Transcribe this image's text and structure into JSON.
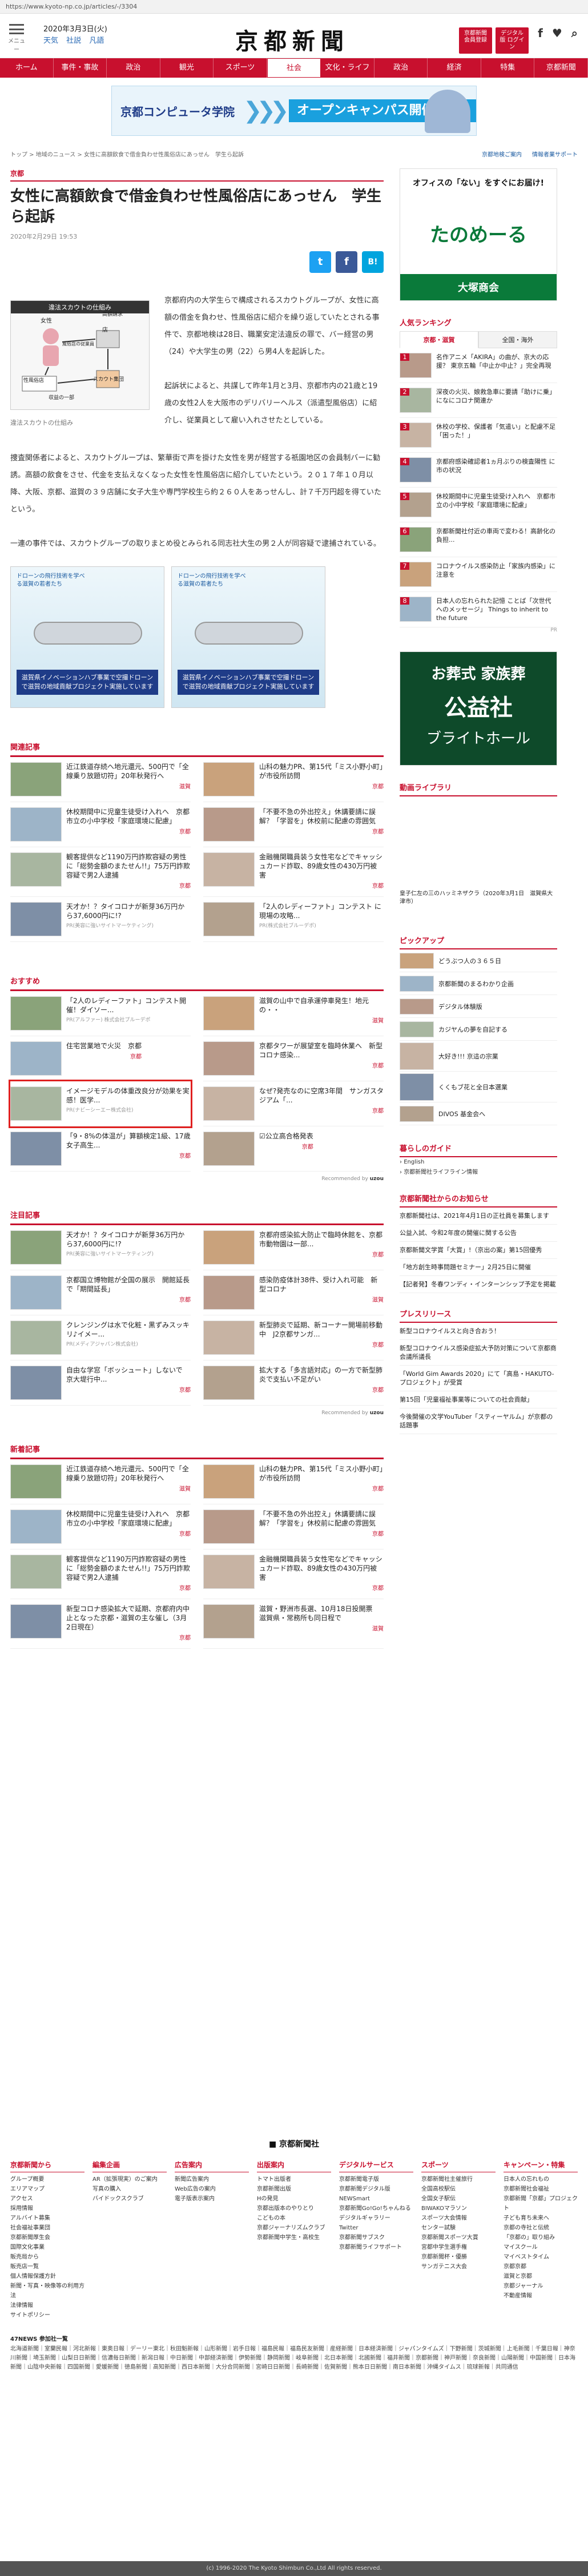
{
  "url": "https://www.kyoto-np.co.jp/articles/-/3304",
  "header": {
    "menu_label": "メニュー",
    "date": "2020年3月3日(火)",
    "weather_links": [
      "天気",
      "社説",
      "凡語"
    ],
    "logo": "京都新聞",
    "buttons": [
      "京都新聞 会員登録",
      "デジタル版 ログイン"
    ],
    "social": [
      "f",
      "Facebook",
      "Twitter"
    ],
    "social_icons": [
      "f-icon",
      "twitter-icon",
      "search-icon"
    ]
  },
  "nav": [
    "ホーム",
    "事件・事故",
    "政治",
    "観光",
    "スポーツ",
    "社会",
    "文化・ライフ",
    "政治",
    "経済",
    "特集",
    "京都新聞"
  ],
  "nav_active": 5,
  "banner": {
    "school": "京都コンピュータ学院",
    "tag": "オープンキャンパス開催中"
  },
  "breadcrumb": "トップ > 地域のニュース > 女性に高額飲食で借金負わせ性風俗店にあっせん　学生ら起訴",
  "breadcrumb_right": [
    "京都地検ご案内",
    "情報者業サポート"
  ],
  "article": {
    "category": "京都",
    "title": "女性に高額飲食で借金負わせ性風俗店にあっせん　学生ら起訴",
    "date": "2020年2月29日 19:53",
    "share": [
      "t",
      "f",
      "B!"
    ],
    "figure_title": "違法スカウトの仕組み",
    "figure_labels": [
      "女性",
      "店",
      "高額請求",
      "スカウト集団",
      "性風俗店",
      "風俗店の従業員",
      "収益の一部"
    ],
    "figure_caption": "違法スカウトの仕組み",
    "p1": "京都府内の大学生らで構成されるスカウトグループが、女性に高額の借金を負わせ、性風俗店に紹介を繰り返していたとされる事件で、京都地検は28日、職業安定法違反の罪で、バー経営の男（24）や大学生の男（22）ら男4人を起訴した。",
    "p2": "起訴状によると、共謀して昨年1月と3月、京都市内の21歳と19歳の女性2人を大阪市のデリバリーヘルス（派遣型風俗店）に紹介し、従業員として雇い入れさせたとしている。",
    "p3": "捜査関係者によると、スカウトグループは、繁華街で声を掛けた女性を男が経営する祇園地区の会員制バーに勧誘。高額の飲食をさせ、代金を支払えなくなった女性を性風俗店に紹介していたという。２０１７年１０月以降、大阪、京都、滋賀の３９店舗に女子大生や専門学校生ら約２６０人をあっせんし、計７千万円超を得ていたという。",
    "p4": "一連の事件では、スカウトグループの取りまとめ役とみられる同志社大生の男２人が同容疑で逮捕されている。"
  },
  "ads": [
    {
      "top": "ドローンの飛行技術を学べる滋賀の若者たち",
      "band": "滋賀県イノベーションハブ事業で空撮ドローンで滋賀の地域貢献プロジェクト実施しています"
    },
    {
      "top": "ドローンの飛行技術を学べる滋賀の若者たち",
      "band": "滋賀県イノベーションハブ事業で空撮ドローンで滋賀の地域貢献プロジェクト実施しています"
    }
  ],
  "related": {
    "heading": "関連記事",
    "items": [
      {
        "text": "近江鉄道存続へ地元還元、500円で「全線乗り放題切符」20年秋発行へ",
        "cat": "滋賀"
      },
      {
        "text": "山科の魅力PR、第15代「ミス小野小町」が市役所訪問",
        "cat": "京都"
      },
      {
        "text": "休校期間中に児童生徒受け入れへ　京都市立の小中学校「家庭環境に配慮」",
        "cat": "京都"
      },
      {
        "text": "「不要不急の外出控え」休講要請に誤解？「学習を」休校前に配慮の雰囲気",
        "cat": "京都"
      },
      {
        "text": "観客提供など1190万円詐欺容疑の男性に「総勢金額のまたせん!!」75万円詐欺　容疑で男2人逮捕",
        "cat": "京都"
      },
      {
        "text": "金融機関職員装う女性宅などでキャッシュカード詐取、89歳女性の430万円被害",
        "cat": "京都"
      },
      {
        "text": "天才か！？タイコロナが新芽36万円から37,6000円に!?",
        "pr": "PR(美容に強いサイトマーケティング)"
      },
      {
        "text": "「2人のレディーファト」コンテスト に 現場の攻略...",
        "pr": "PR(株式会社ブルーデポ)"
      }
    ]
  },
  "recommend": {
    "heading": "おすすめ",
    "items": [
      {
        "text": "「2人のレディーファト」コンテスト開催！ダイソー...",
        "pr": "PR(アルファー) 株式会社プルーデポ"
      },
      {
        "text": "滋賀の山中で自承運停車発生！地元の・・",
        "cat": "滋賀"
      },
      {
        "text": "住宅営業地で火災　京都",
        "cat": "京都"
      },
      {
        "text": "京都タワーが展望室を臨時休業へ　新型コロナ感染...",
        "cat": "京都"
      },
      {
        "text": "イメージモデルの体重改良分が効果を実感！医学...",
        "pr": "PR(ナビーシーエー株式会社)",
        "hl": true
      },
      {
        "text": "なぜ?発売なのに空席3年間　サンガスタジアム「...",
        "cat": "京都"
      },
      {
        "text": "「9・8%の体温が」算額検定1級、17歳女子高生...",
        "cat": "京都"
      },
      {
        "text": "☑公立高合格発表",
        "cat": "京都"
      }
    ],
    "by": "Recommended by",
    "by_brand": "uzou"
  },
  "featured": {
    "heading": "注目記事",
    "items": [
      {
        "text": "天才か！？タイコロナが新芽36万円から37,6000円に!?",
        "pr": "PR(美容に強いサイトマーケティング)"
      },
      {
        "text": "京都府感染拡大防止で臨時休館を、京都市動物園は一部...",
        "cat": "京都"
      },
      {
        "text": "京都国立博物館が全国の展示　開館延長で「期間延長」",
        "cat": "京都"
      },
      {
        "text": "感染防疫体計38件、受け入れ可能　新型コロナ",
        "cat": "滋賀"
      },
      {
        "text": "クレンジングは水で化粧・黒ずみスッキリ♪イメー...",
        "pr": "PR(メディアジャパン株式会社)"
      },
      {
        "text": "新型肺炎で延期、新コーナー開場前移動中　J2京都サンガ...",
        "cat": "京都"
      },
      {
        "text": "自由な学窓「ボッシュート」しないで　京大堤行中...",
        "cat": "京都"
      },
      {
        "text": "拡大する「多言語対応」の一方で新型肺炎で支払い不足がい",
        "cat": "京都"
      }
    ],
    "by": "Recommended by",
    "by_brand": "uzou"
  },
  "latest": {
    "heading": "新着記事",
    "items": [
      {
        "text": "近江鉄道存続へ地元還元、500円で「全線乗り放題切符」20年秋発行へ",
        "cat": "滋賀"
      },
      {
        "text": "山科の魅力PR、第15代「ミス小野小町」が市役所訪問",
        "cat": "京都"
      },
      {
        "text": "休校期間中に児童生徒受け入れへ　京都市立の小中学校「家庭環境に配慮」",
        "cat": "京都"
      },
      {
        "text": "「不要不急の外出控え」休講要請に誤解？「学習を」休校前に配慮の雰囲気",
        "cat": "京都"
      },
      {
        "text": "観客提供など1190万円詐欺容疑の男性に「総勢金額のまたせん!!」75万円詐欺　容疑で男2人逮捕",
        "cat": "京都"
      },
      {
        "text": "金融機関職員装う女性宅などでキャッシュカード詐取、89歳女性の430万円被害",
        "cat": "京都"
      },
      {
        "text": "新型コロナ感染拡大で延期、京都府内中止となった京都・滋賀の主な催し（3月2日現在）",
        "cat": "京都"
      },
      {
        "text": "滋賀・野洲市長選、10月18日投開票　滋賀県・常務所も同日程で",
        "cat": "滋賀"
      }
    ]
  },
  "side": {
    "links": [
      "京都地検ご案内",
      "情報者業サポート"
    ],
    "ad1_line1": "オフィスの「ない」をすぐにお届け!",
    "ad1_brand": "たのめーる",
    "ad1_sub": "大塚商会",
    "ranking_heading": "人気ランキング",
    "tabs": [
      "京都・滋賀",
      "全国・海外"
    ],
    "ranking": [
      "名作アニメ「AKIRA」の曲が、京大の応援？  東京五輪「中止か中止？」完全再現",
      "深夜の火災、娘救急車に要請「助けに乗」になにコロナ関連か",
      "休校の学校、保護者「気遣い」と配慮不足「困った！」",
      "京都府感染確認者1ヵ月ぶりの検査陽性 に 市の状況",
      "休校期間中に児童生徒受け入れへ　京都市立の小中学校「家庭環境に配慮」",
      "京都新聞社付近の車両で変わる！高齢化の負担...",
      "コロナウイルス感染防止「家族内感染」に注意を",
      "日本人の忘れられた記憶 ことば「次世代へのメッセージ」 Things to inherit to the future"
    ],
    "ranking_src": "PR",
    "ad2_lines": [
      "お葬式 家族葬",
      "公益社",
      "ブライトホール"
    ],
    "video_heading": "動画ライブラリ",
    "video_caption": "皇子仁左の三のハッミネザクラ（2020年3月1日　滋賀県大津市）",
    "pickup_heading": "ピックアップ",
    "pickups": [
      "どうぶつ人の３６５日",
      "京都新聞のまるわかり企画",
      "デジタル体験版",
      "カジヤんの夢を自記する",
      "大好き!!! 京這の宗業",
      "くくもブ花と全日本選業",
      "DIVOS 基金会へ"
    ],
    "life_heading": "暮らしのガイド",
    "life_items": [
      "English",
      "京都新聞社ライフライン情報"
    ],
    "notice_heading": "京都新聞社からのお知らせ",
    "notices": [
      "京都新聞社は、2021年4月1日の正社員を募集します",
      "公益入試、今和2年度の開催に関する公告",
      "京都新聞文学賞「大賞」!（京出の案」第15回優秀",
      "「地方創生時事問題セミナー」2月25日に開催",
      "【記者発】冬春ワンディ・インターンシップ予定を掲載"
    ],
    "press_heading": "プレスリリース",
    "press": [
      "新型コロナウイルスと向き合おう！",
      "新型コロナウイルス感染症拡大予防対策について京都商会議所議長",
      "「World Gim Awards 2020」にて「高島・HAKUTO-プロジェクト」が受賞",
      "第15回「児童福祉事業等についての社会貢献」",
      "今後開催の文学YouTuber「スティーヤルム」が京都の話題事"
    ]
  },
  "footer": {
    "logo": "京都新聞社",
    "cols": [
      {
        "h": "京都新聞から",
        "items": [
          "グループ概要",
          "エリアマップ",
          "アクセス",
          "採用情報",
          "アルバイト募集",
          "社会福祉事業団",
          "京都新聞厚生会",
          "国際文化事業",
          "販売局から",
          "販売店一覧",
          "個人情報保護方針",
          "新聞・写真・映像等の利用方法",
          "法律情報",
          "サイトポリシー"
        ]
      },
      {
        "h": "編集企画",
        "items": [
          "AR（拡張現実）のご案内",
          "写真の購入",
          "バイドックスクラブ"
        ]
      },
      {
        "h": "広告案内",
        "items": [
          "新聞広告案内",
          "Web広告の案内",
          "電子版表示案内"
        ]
      },
      {
        "h": "出版案内",
        "items": [
          "トマト出版者",
          "京都新聞出版",
          "Hの発見",
          "京都出版本のやりとり",
          "こどもの本",
          "京都ジャーナリズムクラブ",
          "京都新聞中学生・高校生"
        ]
      },
      {
        "h": "デジタルサービス",
        "items": [
          "京都新聞電子版",
          "京都新聞デジタル版",
          "NEWSmart",
          "京都新聞Go!Go!ちゃんねる",
          "デジタルギャラリー",
          "Twitter",
          "京都新聞サブスク",
          "京都新聞ライフサポート"
        ]
      },
      {
        "h": "スポーツ",
        "items": [
          "京都新聞社主催旅行",
          "全国高校駅伝",
          "全国女子駅伝",
          "BIWAKOマラソン",
          "スポーツ大会情報",
          "センター試験",
          "京都新聞スポーツ大賞",
          "宮都中学生選手権",
          "京都新聞杯・優勝",
          "サンガテニス大会"
        ]
      },
      {
        "h": "キャンペーン・特集",
        "items": [
          "日本人の忘れもの",
          "京都新聞社会福祉",
          "京都新聞「京都」プロジェクト",
          "子ども育ち未来へ",
          "京都の寺社と伝統",
          "「京都の」取り組み",
          "マイスクール",
          "マイベストタイム",
          "京都京都",
          "滋賀と京都",
          "京都ジャーナル",
          "不動産情報"
        ]
      }
    ],
    "news47_heading": "47NEWS  参加社一覧",
    "news47_text": "北海道新聞｜室蘭民報｜河北新報｜東奥日報｜デーリー東北｜秋田魁新報｜山形新聞｜岩手日報｜福島民報｜福島民友新聞｜産経新聞｜日本経済新聞｜ジャパンタイムズ｜下野新聞｜茨城新聞｜上毛新聞｜千葉日報｜神奈川新聞｜埼玉新聞｜山梨日日新聞｜信濃毎日新聞｜新潟日報｜中日新聞｜中部経済新聞｜伊勢新聞｜静岡新聞｜岐阜新聞｜北日本新聞｜北國新聞｜福井新聞｜京都新聞｜神戸新聞｜奈良新聞｜山陽新聞｜中国新聞｜日本海新聞｜山陰中央新報｜四国新聞｜愛媛新聞｜徳島新聞｜高知新聞｜西日本新聞｜大分合同新聞｜宮崎日日新聞｜長崎新聞｜佐賀新聞｜熊本日日新聞｜南日本新聞｜沖縄タイムス｜琉球新報｜共同通信",
    "copyright": "(c) 1996-2020 The Kyoto Shimbun Co.,Ltd All rights reserved."
  },
  "colors": {
    "brand": "#c8102e",
    "highlight": "#e02020"
  }
}
